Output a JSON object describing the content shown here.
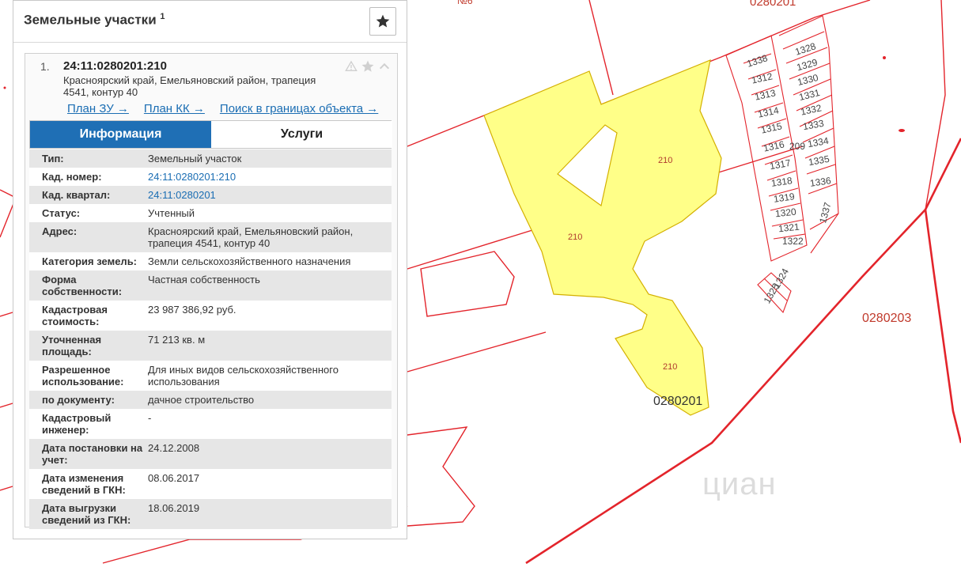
{
  "panel": {
    "title": "Земельные участки",
    "title_sup": "1",
    "favorite_icon": "star-icon"
  },
  "item": {
    "number": "1.",
    "cad_number": "24:11:0280201:210",
    "address_line": "Красноярский край, Емельяновский район, трапеция 4541, контур 40",
    "icons": [
      "warning-icon",
      "star-icon",
      "chevron-up-icon"
    ],
    "links": [
      {
        "label": "План ЗУ →"
      },
      {
        "label": "План КК →"
      },
      {
        "label": "Поиск в границах объекта →"
      }
    ],
    "tabs": [
      {
        "label": "Информация",
        "active": true
      },
      {
        "label": "Услуги",
        "active": false
      }
    ],
    "rows": [
      {
        "key": "Тип:",
        "value": "Земельный участок"
      },
      {
        "key": "Кад. номер:",
        "value": "24:11:0280201:210",
        "link": true
      },
      {
        "key": "Кад. квартал:",
        "value": "24:11:0280201",
        "link": true
      },
      {
        "key": "Статус:",
        "value": "Учтенный"
      },
      {
        "key": "Адрес:",
        "value": "Красноярский край, Емельяновский район, трапеция 4541, контур 40"
      },
      {
        "key": "Категория земель:",
        "value": "Земли сельскохозяйственного назначения"
      },
      {
        "key": "Форма собственности:",
        "value": "Частная собственность"
      },
      {
        "key": "Кадастровая стоимость:",
        "value": "23 987 386,92 руб."
      },
      {
        "key": "Уточненная площадь:",
        "value": "71 213 кв. м"
      },
      {
        "key": "Разрешенное использование:",
        "value": "Для иных видов сельскохозяйственного использования"
      },
      {
        "key": "по документу:",
        "value": "дачное строительство"
      },
      {
        "key": "Кадастровый инженер:",
        "value": "-"
      },
      {
        "key": "Дата постановки на учет:",
        "value": "24.12.2008"
      },
      {
        "key": "Дата изменения сведений в ГКН:",
        "value": "08.06.2017"
      },
      {
        "key": "Дата выгрузки сведений из ГКН:",
        "value": "18.06.2019"
      }
    ]
  },
  "map": {
    "quarter_labels": [
      "0280201",
      "0280203",
      "0280201"
    ],
    "plot_labels": [
      "210",
      "210",
      "210",
      "209"
    ],
    "subplot_labels": [
      "1338",
      "1312",
      "1313",
      "1314",
      "1315",
      "1316",
      "1317",
      "1318",
      "1319",
      "1320",
      "1321",
      "1322",
      "1328",
      "1329",
      "1330",
      "1331",
      "1332",
      "1333",
      "1334",
      "1335",
      "1336",
      "1337",
      "1324",
      "1325"
    ],
    "edge_fragment": "№6",
    "watermark": "циан",
    "colors": {
      "boundary": "#e3242b",
      "plot_fill": "#ffff88",
      "plot_stroke": "#d4b000",
      "tab_active": "#1f6fb5",
      "link": "#1a6db3"
    }
  }
}
